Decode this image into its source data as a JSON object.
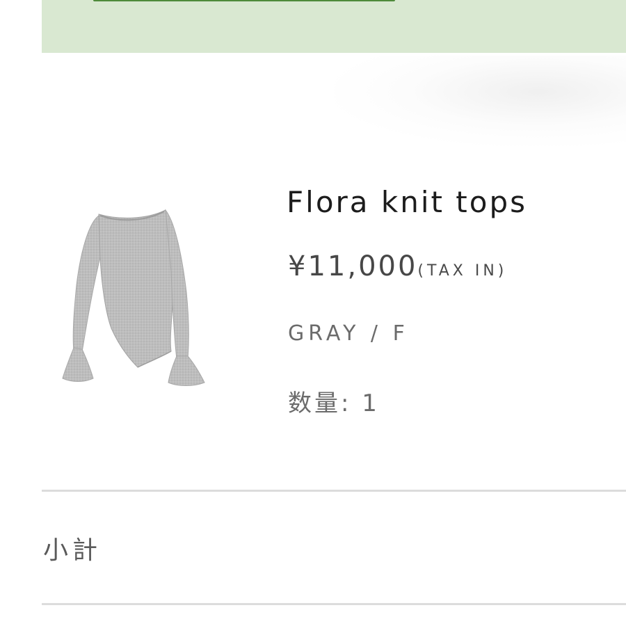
{
  "product": {
    "name": "Flora knit tops",
    "price": "¥11,000",
    "tax_note": "(TAX IN)",
    "variant": "GRAY / F",
    "quantity": "数量: 1",
    "image_icon": "sweater-product-image",
    "color": "#b9b9b9"
  },
  "summary": {
    "subtotal_label": "小計"
  },
  "colors": {
    "banner": "#d9e8d1",
    "banner_button_border": "#4e8a3a",
    "divider": "#dcdcdc"
  }
}
